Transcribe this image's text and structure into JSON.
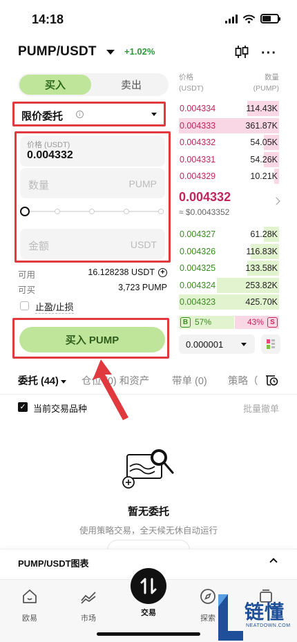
{
  "status_bar": {
    "time": "14:18"
  },
  "header": {
    "pair": "PUMP/USDT",
    "change": "+1.02%",
    "change_color": "#2e9a3c"
  },
  "order_panel": {
    "buy_tab": "买入",
    "sell_tab": "卖出",
    "order_type": "限价委托",
    "price_label": "价格 (USDT)",
    "price_value": "0.004332",
    "quantity_placeholder": "数量",
    "quantity_unit": "PUMP",
    "amount_placeholder": "金额",
    "amount_unit": "USDT",
    "slider_level": 0,
    "available_label": "可用",
    "available_value": "16.128238 USDT",
    "can_buy_label": "可买",
    "can_buy_value": "3,723 PUMP",
    "tpsl_label": "止盈/止损",
    "buy_button": "买入 PUMP",
    "accent_color": "#bfe59a"
  },
  "order_book": {
    "price_header": "价格",
    "price_unit": "(USDT)",
    "amount_header": "数量",
    "amount_unit": "(PUMP)",
    "asks": [
      {
        "price": "0.004334",
        "amount": "114.43K",
        "depth": 0.32
      },
      {
        "price": "0.004333",
        "amount": "361.87K",
        "depth": 1.0
      },
      {
        "price": "0.004332",
        "amount": "54.05K",
        "depth": 0.15
      },
      {
        "price": "0.004331",
        "amount": "54.26K",
        "depth": 0.15
      },
      {
        "price": "0.004329",
        "amount": "10.21K",
        "depth": 0.05
      }
    ],
    "mid_price": "0.004332",
    "mid_fiat": "≈ $0.0043352",
    "bids": [
      {
        "price": "0.004327",
        "amount": "61.28K",
        "depth": 0.15
      },
      {
        "price": "0.004326",
        "amount": "116.83K",
        "depth": 0.28
      },
      {
        "price": "0.004325",
        "amount": "133.58K",
        "depth": 0.32
      },
      {
        "price": "0.004324",
        "amount": "253.82K",
        "depth": 0.62
      },
      {
        "price": "0.004323",
        "amount": "425.70K",
        "depth": 1.0
      }
    ],
    "buy_badge": "B",
    "buy_ratio": "57%",
    "sell_ratio": "43%",
    "sell_badge": "S",
    "precision": "0.000001",
    "ask_color": "#c2255c",
    "bid_color": "#3b8a23"
  },
  "tabs": {
    "orders": "委托 (44)",
    "positions": "仓位 (0) 和资产",
    "copy": "带单 (0)",
    "strategy": "策略（"
  },
  "orders_section": {
    "current_pair_label": "当前交易品种",
    "batch_cancel": "批量撤单",
    "empty_title": "暂无委托",
    "empty_subtitle": "使用策略交易，全天候无休自动运行"
  },
  "chart_panel": {
    "label": "PUMP/USDT图表"
  },
  "bottom_nav": {
    "items": [
      "欧易",
      "市场",
      "交易",
      "探索",
      ""
    ]
  },
  "watermark": {
    "text": "链懂",
    "sub": "NEATDOWN.COM"
  }
}
